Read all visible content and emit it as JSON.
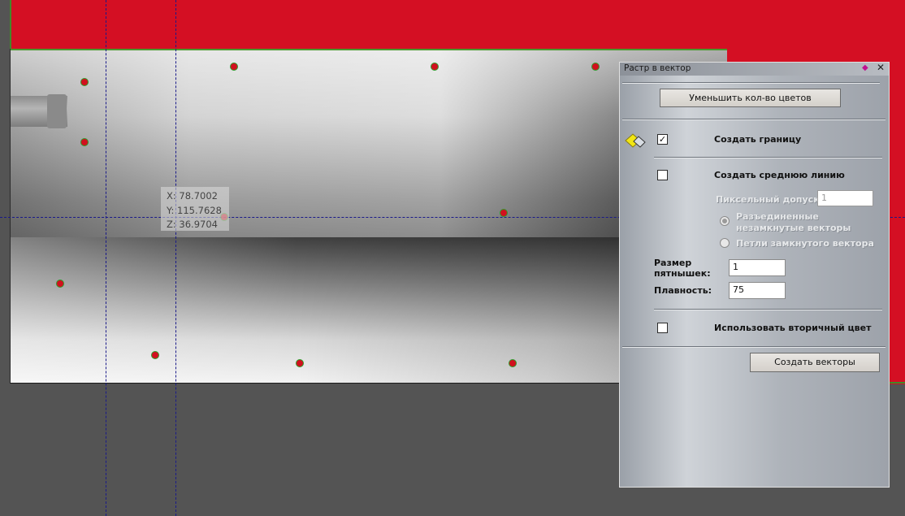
{
  "coordinates": {
    "x": "X: 78.7002",
    "y": "Y: 115.7628",
    "z": "Z: 36.9704"
  },
  "panel": {
    "title": "Растр в вектор",
    "reduce_colors_button": "Уменьшить кол-во цветов",
    "create_border": {
      "label": "Создать границу",
      "checked": true,
      "mark": "✓"
    },
    "create_centerline": {
      "label": "Создать среднюю линию",
      "checked": false
    },
    "pixel_tolerance": {
      "label": "Пиксельный допуск:",
      "value": "1"
    },
    "radio_options": [
      {
        "label_line1": "Разъединенные",
        "label_line2": "незамкнутые векторы",
        "selected": true
      },
      {
        "label_line1": "Петли замкнутого вектора",
        "label_line2": "",
        "selected": false
      }
    ],
    "speck_size": {
      "label_line1": "Размер",
      "label_line2": "пятнышек:",
      "value": "1"
    },
    "smoothness": {
      "label": "Плавность:",
      "value": "75"
    },
    "use_secondary_color": {
      "label": "Использовать вторичный цвет",
      "checked": false
    },
    "create_vectors_button": "Создать векторы"
  },
  "icons": {
    "pin": "pin-icon",
    "close": "close-icon",
    "border": "diamond-tool-icon"
  },
  "colors": {
    "background": "#545454",
    "red": "#d40f23",
    "point": "#d1101e",
    "guide": "#1a1a8a"
  }
}
